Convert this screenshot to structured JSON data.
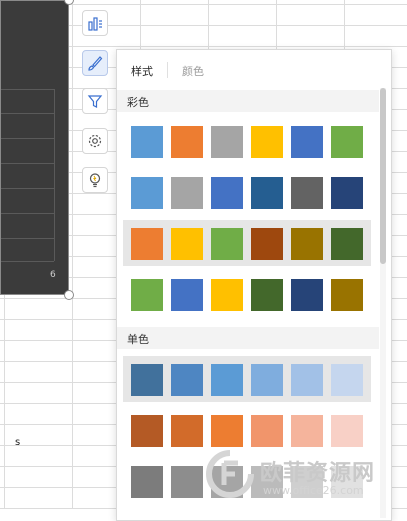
{
  "sheet": {
    "cell_text": "s"
  },
  "chart": {
    "axis_label": "6"
  },
  "toolbar": {
    "icons": [
      "chart-elements-icon",
      "brush-icon",
      "filter-icon",
      "gear-icon",
      "lightbulb-icon"
    ],
    "active": "brush-icon"
  },
  "panel": {
    "tab_style": "样式",
    "tab_color": "颜色",
    "section_colorful": "彩色",
    "section_mono": "单色",
    "colorful_rows": [
      [
        "#5b9bd5",
        "#ed7d31",
        "#a5a5a5",
        "#ffc000",
        "#4472c4",
        "#70ad47"
      ],
      [
        "#5b9bd5",
        "#a5a5a5",
        "#4472c4",
        "#255e91",
        "#636363",
        "#264478"
      ],
      [
        "#ed7d31",
        "#ffc000",
        "#70ad47",
        "#9e480e",
        "#997300",
        "#43682b"
      ],
      [
        "#70ad47",
        "#4472c4",
        "#ffc000",
        "#43682b",
        "#264478",
        "#997300"
      ]
    ],
    "mono_rows": [
      [
        "#41719c",
        "#4e86c2",
        "#5b9bd5",
        "#7fadde",
        "#a2c1e7",
        "#c5d6ee"
      ],
      [
        "#b45a25",
        "#d26b2a",
        "#ed7d31",
        "#f1956b",
        "#f5b49c",
        "#f8d0c6"
      ],
      [
        "#7c7c7c",
        "#8d8d8d",
        "#a5a5a5",
        "#bbbbbb",
        "#cfcfcf",
        "#e1e1e1"
      ]
    ]
  },
  "watermark": {
    "text": "欧菲资源网",
    "url": "www.office26.com"
  }
}
